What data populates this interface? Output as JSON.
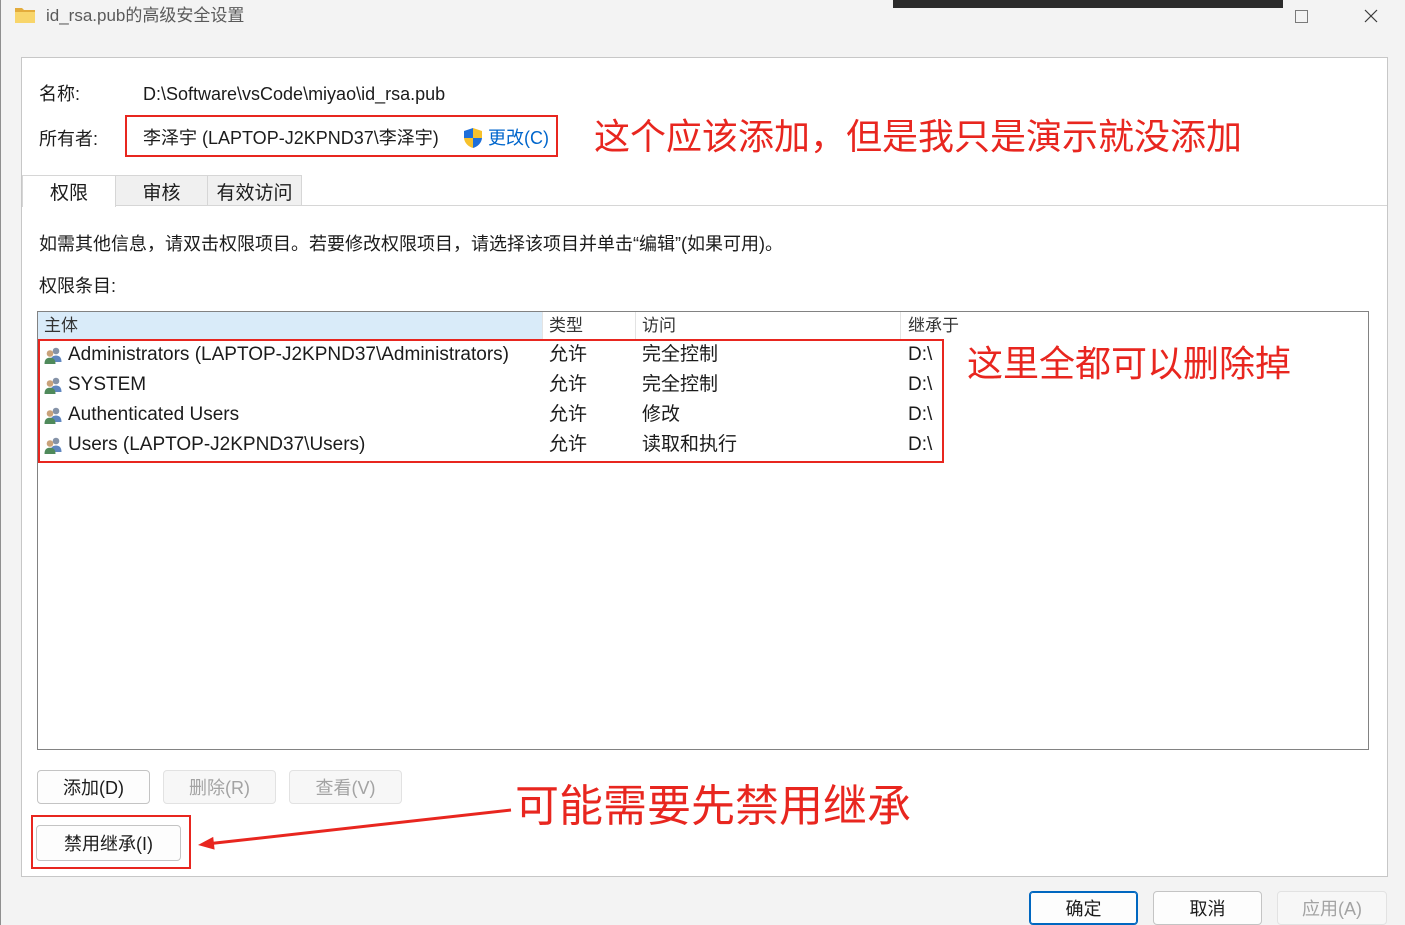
{
  "window": {
    "title": "id_rsa.pub的高级安全设置",
    "icon": "folder-icon",
    "controls": {
      "maximize_icon": "maximize-icon",
      "close_icon": "close-icon"
    }
  },
  "info": {
    "name_label": "名称:",
    "name_value": "D:\\Software\\vsCode\\miyao\\id_rsa.pub",
    "owner_label": "所有者:",
    "owner_value": "李泽宇 (LAPTOP-J2KPND37\\李泽宇)",
    "change_icon": "uac-shield-icon",
    "change_link": "更改(C)"
  },
  "tabs": [
    {
      "label": "权限",
      "selected": true
    },
    {
      "label": "审核",
      "selected": false
    },
    {
      "label": "有效访问",
      "selected": false
    }
  ],
  "permissions": {
    "hint": "如需其他信息，请双击权限项目。若要修改权限项目，请选择该项目并单击“编辑”(如果可用)。",
    "entries_label": "权限条目:",
    "columns": [
      "主体",
      "类型",
      "访问",
      "继承于"
    ],
    "sorted_column_index": 0,
    "row_icon": "user-group-icon",
    "rows": [
      {
        "principal": "Administrators (LAPTOP-J2KPND37\\Administrators)",
        "type": "允许",
        "access": "完全控制",
        "inherited_from": "D:\\"
      },
      {
        "principal": "SYSTEM",
        "type": "允许",
        "access": "完全控制",
        "inherited_from": "D:\\"
      },
      {
        "principal": "Authenticated Users",
        "type": "允许",
        "access": "修改",
        "inherited_from": "D:\\"
      },
      {
        "principal": "Users (LAPTOP-J2KPND37\\Users)",
        "type": "允许",
        "access": "读取和执行",
        "inherited_from": "D:\\"
      }
    ]
  },
  "buttons": {
    "add": {
      "label": "添加(D)",
      "enabled": true
    },
    "remove": {
      "label": "删除(R)",
      "enabled": false
    },
    "view": {
      "label": "查看(V)",
      "enabled": false
    },
    "disable_inheritance": {
      "label": "禁用继承(I)",
      "enabled": true
    },
    "ok": {
      "label": "确定",
      "enabled": true,
      "default": true
    },
    "cancel": {
      "label": "取消",
      "enabled": true
    },
    "apply": {
      "label": "应用(A)",
      "enabled": false
    }
  },
  "annotations": {
    "owner_note": "这个应该添加，但是我只是演示就没添加",
    "entries_note": "这里全都可以删除掉",
    "inheritance_note": "可能需要先禁用继承",
    "arrow": "arrow-left-icon"
  },
  "colors": {
    "annotation_red": "#e8261f",
    "link_blue": "#0066cc",
    "sorted_header_bg": "#d9ebf9",
    "default_button_border": "#0067c0",
    "window_bg": "#f3f3f3"
  }
}
